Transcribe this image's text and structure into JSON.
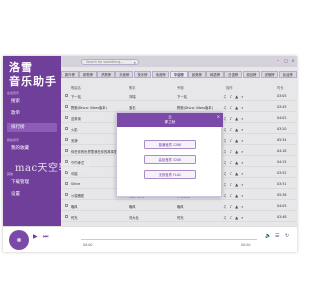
{
  "app": {
    "logo_line1": "洛雪",
    "logo_line2": "音乐助手"
  },
  "sidebar": {
    "section1": "在线音乐",
    "items1": [
      {
        "label": "搜索"
      },
      {
        "label": "歌单"
      },
      {
        "label": "排行榜"
      }
    ],
    "section2": "我的音乐",
    "items2": [
      {
        "label": "我的收藏"
      }
    ],
    "section3": "其他",
    "items3": [
      {
        "label": "下载管理"
      },
      {
        "label": "设置"
      }
    ]
  },
  "header": {
    "search_placeholder": "Search for something..."
  },
  "tabs": [
    {
      "label": "飙升榜"
    },
    {
      "label": "新歌榜"
    },
    {
      "label": "热歌榜"
    },
    {
      "label": "抖音榜"
    },
    {
      "label": "快手榜"
    },
    {
      "label": "电音榜"
    },
    {
      "label": "华语榜"
    },
    {
      "label": "欧美榜"
    },
    {
      "label": "韩语榜"
    },
    {
      "label": "日语榜"
    },
    {
      "label": "原创榜"
    },
    {
      "label": "说唱榜"
    },
    {
      "label": "民谣榜"
    }
  ],
  "table": {
    "headers": {
      "title": "歌曲名",
      "artist": "歌手",
      "album": "专辑",
      "ops": "操作",
      "duration": "时长"
    },
    "rows": [
      {
        "title": "下一站",
        "artist": "刘瑞",
        "album": "下一站",
        "duration": "03:05"
      },
      {
        "title": "野狼(Disco: Vibes版本)",
        "artist": "宝石",
        "album": "野狼(Disco: Vibes版本)",
        "duration": "03:45"
      },
      {
        "title": "这条街",
        "artist": "大刘",
        "album": "这条街",
        "duration": "04:02"
      },
      {
        "title": "火影",
        "artist": "大刘",
        "album": "火影",
        "duration": "03:20"
      },
      {
        "title": "安静",
        "artist": "周杰伦",
        "album": "安静",
        "duration": "05:34"
      },
      {
        "title": "你在你的世界里我在你的故事里",
        "artist": "我的世界",
        "album": "我的世界",
        "duration": "04:18"
      },
      {
        "title": "你的承诺",
        "artist": "海鸣威",
        "album": "你的承诺",
        "duration": "04:15"
      },
      {
        "title": "可能",
        "artist": "程响",
        "album": "可能",
        "duration": "03:52"
      },
      {
        "title": "Shine",
        "artist": "盛",
        "album": "Shine",
        "duration": "03:31"
      },
      {
        "title": "沙漠骆驼",
        "artist": "展展与罗罗",
        "album": "沙漠骆驼",
        "duration": "05:38"
      },
      {
        "title": "晚风",
        "artist": "晚风",
        "album": "晚风",
        "duration": "04:05"
      },
      {
        "title": "时光",
        "artist": "刘大壮",
        "album": "时光",
        "duration": "03:48"
      },
      {
        "title": "春风十里",
        "artist": "鹿先森乐队",
        "album": "春风十里",
        "duration": "04:55"
      },
      {
        "title": "成都",
        "artist": "赵雷",
        "album": "成都",
        "duration": "05:28"
      }
    ]
  },
  "dialog": {
    "title1": "云",
    "title2": "那之秋",
    "options": [
      {
        "label": "普通音质 128K"
      },
      {
        "label": "高品音质 320K"
      },
      {
        "label": "无损音质 FLAC"
      }
    ]
  },
  "player": {
    "time_current": "00:00",
    "time_total": "00:00"
  },
  "watermark": "mac天空软件园",
  "colors": {
    "accent": "#6f3f99",
    "accent_light": "#8c5cb8"
  }
}
